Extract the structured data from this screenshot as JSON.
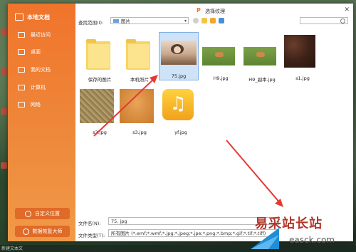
{
  "sidebar": {
    "title": "本地文档",
    "items": [
      {
        "label": "最近访问"
      },
      {
        "label": "桌面"
      },
      {
        "label": "我的文档"
      },
      {
        "label": "计算机"
      },
      {
        "label": "网络"
      }
    ],
    "buttons": [
      {
        "label": "自定义位置"
      },
      {
        "label": "数据恢复大师"
      }
    ]
  },
  "dialog": {
    "title": "选择纹理",
    "toolbar": {
      "look_in_label": "查找范围(I):",
      "look_in_value": "图片"
    },
    "files": [
      {
        "name": "保存的图片",
        "kind": "folder"
      },
      {
        "name": "本机照片",
        "kind": "folder"
      },
      {
        "name": "75.jpg",
        "kind": "photo",
        "selected": true
      },
      {
        "name": "H9.jpg",
        "kind": "deer"
      },
      {
        "name": "H9_副本.jpg",
        "kind": "deer"
      },
      {
        "name": "s1.jpg",
        "kind": "dark"
      },
      {
        "name": "s2.jpg",
        "kind": "sand"
      },
      {
        "name": "s3.jpg",
        "kind": "wood"
      },
      {
        "name": "yf.jpg",
        "kind": "music"
      }
    ],
    "filename_label": "文件名(N):",
    "filename_value": "75. jpg",
    "filetype_label": "文件类型(T):",
    "filetype_value": "所有图片 (*.emf;*.wmf;*.jpg;*.jpeg;*.jpe;*.png;*.bmp;*.gif;*.tif;*.tiff)"
  },
  "taskbar": {
    "text": "新建文本文"
  },
  "watermark": {
    "cn": "易采站长站",
    "en": "easck.com"
  },
  "colors": {
    "sidebar": "#f0742b",
    "accent": "#f07128",
    "arrow": "#e53935",
    "selected": "#cfe3f8"
  }
}
